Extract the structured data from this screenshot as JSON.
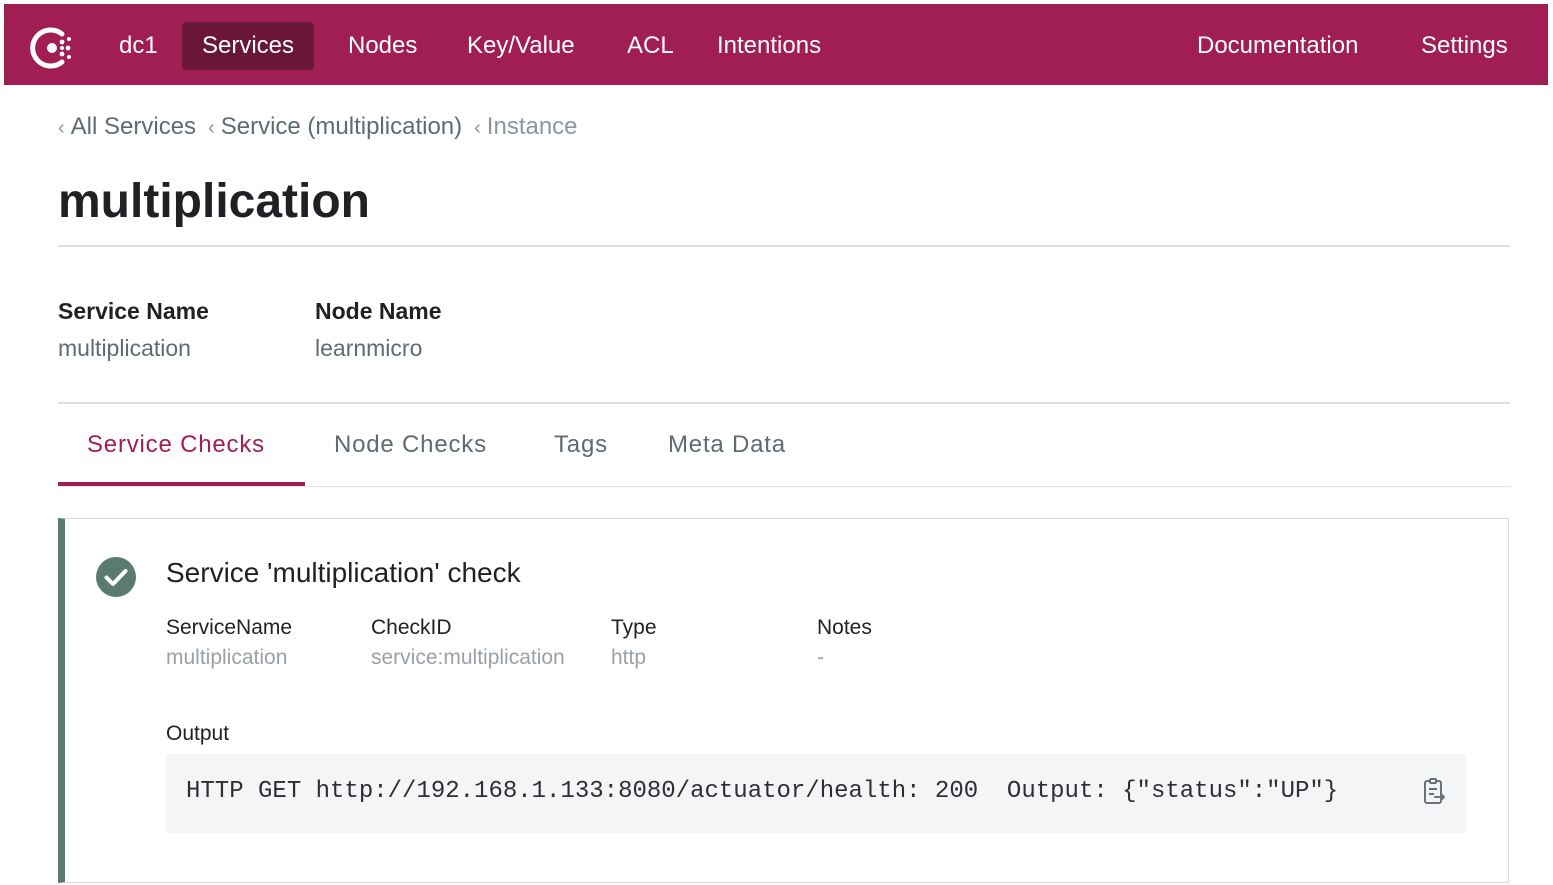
{
  "nav": {
    "datacenter": "dc1",
    "items": [
      "Services",
      "Nodes",
      "Key/Value",
      "ACL",
      "Intentions"
    ],
    "right": [
      "Documentation",
      "Settings"
    ],
    "brand_color": "#a11e54",
    "active_color": "#6a1638"
  },
  "breadcrumb": {
    "items": [
      "All Services",
      "Service (multiplication)"
    ],
    "current": "Instance"
  },
  "page": {
    "title": "multiplication"
  },
  "meta": {
    "service_name_label": "Service Name",
    "service_name": "multiplication",
    "node_name_label": "Node Name",
    "node_name": "learnmicro"
  },
  "tabs": {
    "items": [
      "Service Checks",
      "Node Checks",
      "Tags",
      "Meta Data"
    ],
    "active": "Service Checks"
  },
  "check": {
    "status_icon": "check-circle-icon",
    "status_color": "#5a7b6e",
    "title": "Service 'multiplication' check",
    "fields": [
      {
        "label": "ServiceName",
        "value": "multiplication"
      },
      {
        "label": "CheckID",
        "value": "service:multiplication"
      },
      {
        "label": "Type",
        "value": "http"
      },
      {
        "label": "Notes",
        "value": "-"
      }
    ],
    "output_label": "Output",
    "output": "HTTP GET http://192.168.1.133:8080/actuator/health: 200  Output: {\"status\":\"UP\"}",
    "copy_icon": "copy-icon"
  }
}
